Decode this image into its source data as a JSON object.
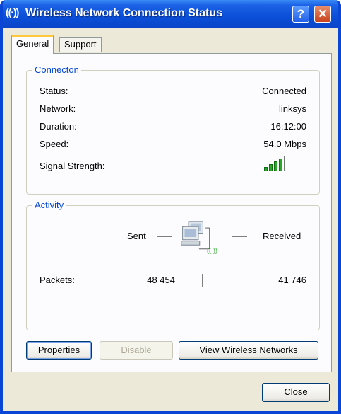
{
  "window": {
    "title": "Wireless Network Connection Status",
    "title_icon": "((·))",
    "help_glyph": "?",
    "close_glyph": "✕"
  },
  "tabs": [
    {
      "label": "General",
      "active": true
    },
    {
      "label": "Support",
      "active": false
    }
  ],
  "connection": {
    "legend": "Connecton",
    "rows": [
      {
        "label": "Status:",
        "value": "Connected"
      },
      {
        "label": "Network:",
        "value": "linksys"
      },
      {
        "label": "Duration:",
        "value": "16:12:00"
      },
      {
        "label": "Speed:",
        "value": "54.0 Mbps"
      }
    ],
    "signal_label": "Signal Strength:",
    "signal_bars_filled": 4,
    "signal_bars_total": 5,
    "signal_color": "#2aa82a"
  },
  "activity": {
    "legend": "Activity",
    "sent_label": "Sent",
    "received_label": "Received",
    "packets_label": "Packets:",
    "packets_sent": "48 454",
    "packets_received": "41 746",
    "icon_caption": "((·))"
  },
  "buttons": {
    "properties": "Properties",
    "disable": "Disable",
    "view_wireless": "View Wireless Networks",
    "close": "Close"
  },
  "colors": {
    "title_bar": "#0b4fd8",
    "legend_text": "#0046d5",
    "tab_highlight": "#ffc73c"
  }
}
